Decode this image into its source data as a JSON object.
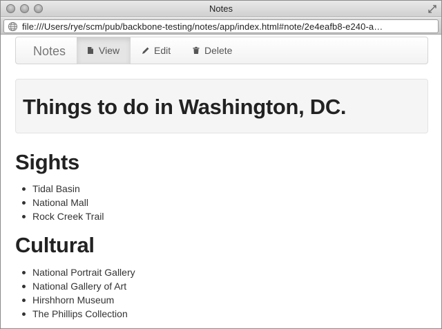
{
  "window": {
    "title": "Notes"
  },
  "address_bar": {
    "url": "file:///Users/rye/scm/pub/backbone-testing/notes/app/index.html#note/2e4eafb8-e240-a…"
  },
  "navbar": {
    "brand": "Notes",
    "items": [
      {
        "label": "View",
        "icon": "file-icon",
        "active": true
      },
      {
        "label": "Edit",
        "icon": "pencil-icon",
        "active": false
      },
      {
        "label": "Delete",
        "icon": "trash-icon",
        "active": false
      }
    ]
  },
  "note": {
    "title": "Things to do in Washington, DC.",
    "sections": [
      {
        "heading": "Sights",
        "items": [
          "Tidal Basin",
          "National Mall",
          "Rock Creek Trail"
        ]
      },
      {
        "heading": "Cultural",
        "items": [
          "National Portrait Gallery",
          "National Gallery of Art",
          "Hirshhorn Museum",
          "The Phillips Collection"
        ]
      }
    ]
  }
}
